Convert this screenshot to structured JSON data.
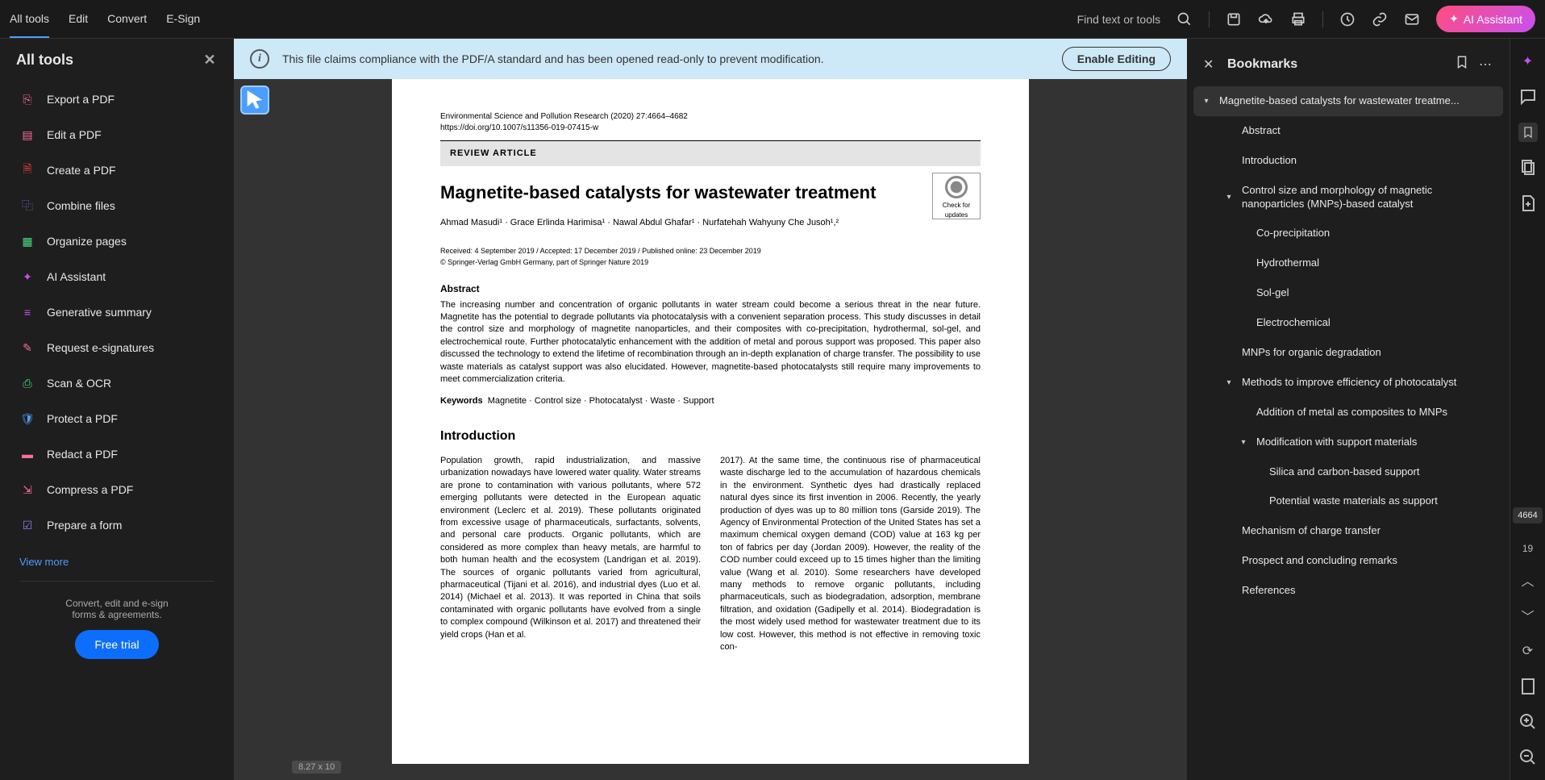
{
  "top_menu": {
    "all_tools": "All tools",
    "edit": "Edit",
    "convert": "Convert",
    "esign": "E-Sign"
  },
  "top_right": {
    "find_text": "Find text or tools",
    "ai_assistant": "AI Assistant"
  },
  "left_panel": {
    "title": "All tools",
    "items": {
      "export": "Export a PDF",
      "edit": "Edit a PDF",
      "create": "Create a PDF",
      "combine": "Combine files",
      "organize": "Organize pages",
      "ai": "AI Assistant",
      "summary": "Generative summary",
      "esign": "Request e-signatures",
      "scan": "Scan & OCR",
      "protect": "Protect a PDF",
      "redact": "Redact a PDF",
      "compress": "Compress a PDF",
      "form": "Prepare a form"
    },
    "view_more": "View more",
    "footer_line1": "Convert, edit and e-sign",
    "footer_line2": "forms & agreements.",
    "free_trial": "Free trial"
  },
  "info_banner": {
    "text": "This file claims compliance with the PDF/A standard and has been opened read-only to prevent modification.",
    "button": "Enable Editing"
  },
  "doc": {
    "journal": "Environmental Science and Pollution Research (2020) 27:4664–4682",
    "doi": "https://doi.org/10.1007/s11356-019-07415-w",
    "review_label": "REVIEW ARTICLE",
    "check_updates_line1": "Check for",
    "check_updates_line2": "updates",
    "title": "Magnetite-based catalysts for wastewater treatment",
    "authors_html": "Ahmad Masudi¹ · Grace Erlinda Harimisa¹ · Nawal Abdul Ghafar¹ · Nurfatehah Wahyuny Che Jusoh¹,²",
    "received": "Received: 4 September 2019 / Accepted: 17 December 2019 / Published online: 23 December 2019",
    "copyright": "© Springer-Verlag GmbH Germany, part of Springer Nature 2019",
    "abstract_h": "Abstract",
    "abstract": "The increasing number and concentration of organic pollutants in water stream could become a serious threat in the near future. Magnetite has the potential to degrade pollutants via photocatalysis with a convenient separation process. This study discusses in detail the control size and morphology of magnetite nanoparticles, and their composites with co-precipitation, hydrothermal, sol-gel, and electrochemical route. Further photocatalytic enhancement with the addition of metal and porous support was proposed. This paper also discussed the technology to extend the lifetime of recombination through an in-depth explanation of charge transfer. The possibility to use waste materials as catalyst support was also elucidated. However, magnetite-based photocatalysts still require many improvements to meet commercialization criteria.",
    "keywords_label": "Keywords",
    "keywords": "Magnetite · Control size · Photocatalyst · Waste · Support",
    "intro_h": "Introduction",
    "col1": "Population growth, rapid industrialization, and massive urbanization nowadays have lowered water quality. Water streams are prone to contamination with various pollutants, where 572 emerging pollutants were detected in the European aquatic environment (Leclerc et al. 2019). These pollutants originated from excessive usage of pharmaceuticals, surfactants, solvents, and personal care products. Organic pollutants, which are considered as more complex than heavy metals, are harmful to both human health and the ecosystem (Landrigan et al. 2019). The sources of organic pollutants varied from agricultural, pharmaceutical (Tijani et al. 2016), and industrial dyes (Luo et al. 2014) (Michael et al. 2013). It was reported in China that soils contaminated with organic pollutants have evolved from a single to complex compound (Wilkinson et al. 2017) and threatened their yield crops (Han et al.",
    "col2": "2017). At the same time, the continuous rise of pharmaceutical waste discharge led to the accumulation of hazardous chemicals in the environment. Synthetic dyes had drastically replaced natural dyes since its first invention in 2006. Recently, the yearly production of dyes was up to 80 million tons (Garside 2019). The Agency of Environmental Protection of the United States has set a maximum chemical oxygen demand (COD) value at 163 kg per ton of fabrics per day (Jordan 2009). However, the reality of the COD number could exceed up to 15 times higher than the limiting value (Wang et al. 2010).\n  Some researchers have developed many methods to remove organic pollutants, including pharmaceuticals, such as biodegradation, adsorption, membrane filtration, and oxidation (Gadipelly et al. 2014). Biodegradation is the most widely used method for wastewater treatment due to its low cost. However, this method is not effective in removing toxic con-",
    "dim_label": "8.27 x 10"
  },
  "bookmarks": {
    "title": "Bookmarks",
    "items": {
      "root": "Magnetite-based catalysts for wastewater treatme...",
      "abstract": "Abstract",
      "intro": "Introduction",
      "control": "Control size and morphology of magnetic nanoparticles (MNPs)-based catalyst",
      "coprecip": "Co-precipitation",
      "hydro": "Hydrothermal",
      "solgel": "Sol-gel",
      "electro": "Electrochemical",
      "mnps": "MNPs for organic degradation",
      "methods": "Methods to improve efficiency of photocatalyst",
      "addition": "Addition of metal as composites to MNPs",
      "modification": "Modification with support materials",
      "silica": "Silica and carbon-based support",
      "potential": "Potential waste materials as support",
      "mechanism": "Mechanism of charge transfer",
      "prospect": "Prospect and concluding remarks",
      "references": "References"
    }
  },
  "page_info": {
    "current": "4664",
    "total": "19"
  }
}
